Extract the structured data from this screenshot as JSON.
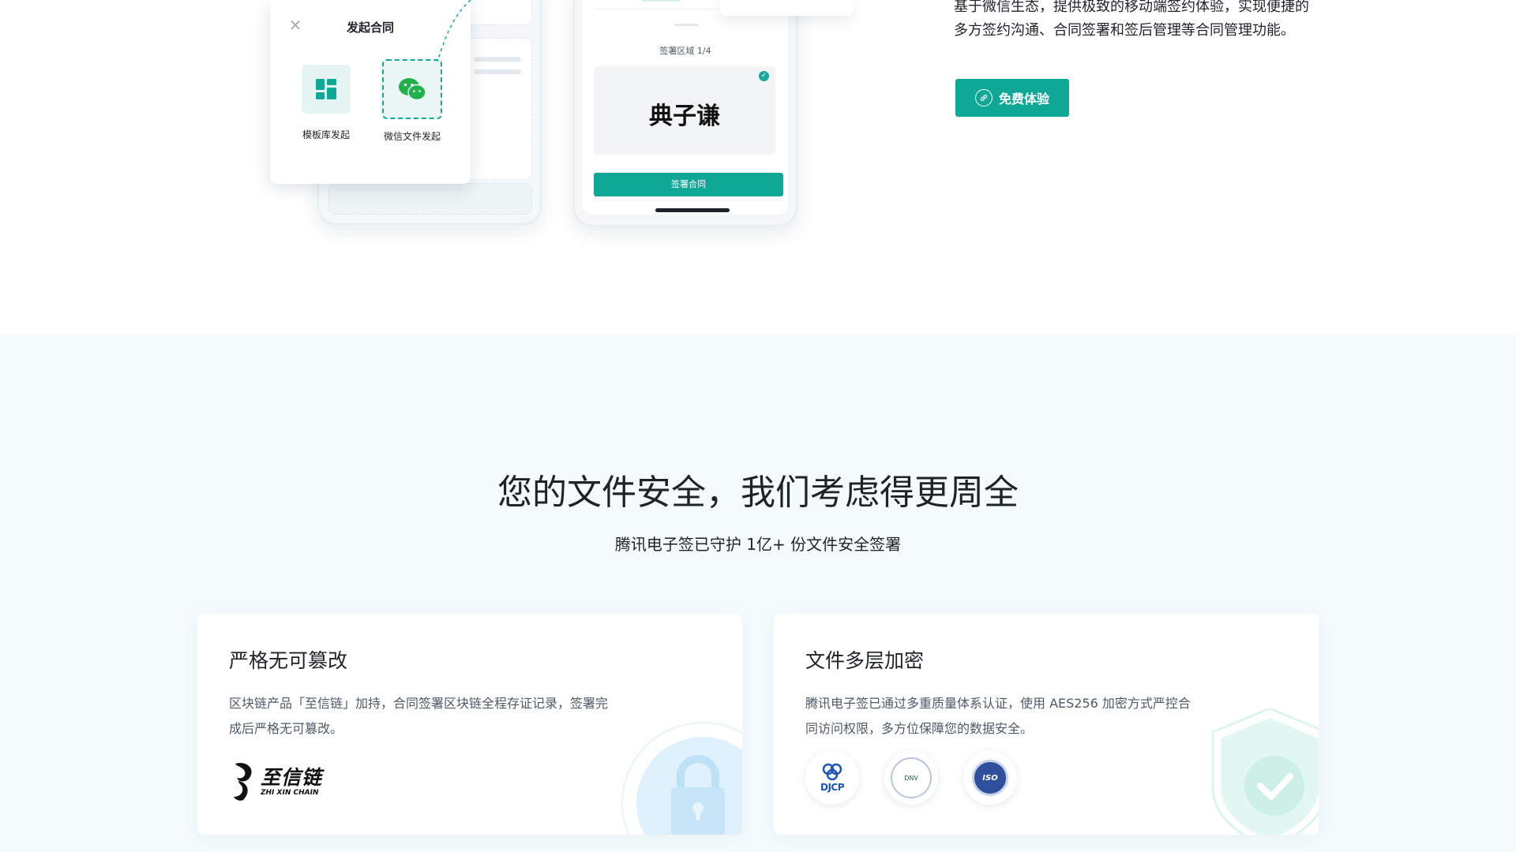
{
  "popup": {
    "title": "发起合同",
    "close_icon": "close-icon",
    "options": [
      {
        "label": "模板库发起",
        "icon": "template-grid-icon"
      },
      {
        "label": "微信文件发起",
        "icon": "wechat-icon"
      }
    ]
  },
  "phone": {
    "area_label": "签署区域 1/4",
    "signature": "典子谦",
    "sign_button": "签署合同"
  },
  "intro": {
    "line1": "基于微信生态，提供极致的移动端签约体验，实现便捷的",
    "line2": "多方签约沟通、合同签署和签后管理等合同管理功能。",
    "cta_label": "免费体验",
    "cta_icon": "link-icon"
  },
  "security": {
    "title": "您的文件安全，我们考虑得更周全",
    "subtitle": "腾讯电子签已守护 1亿+ 份文件安全签署",
    "cards": [
      {
        "title": "严格无可篡改",
        "desc": "区块链产品「至信链」加持，合同签署区块链全程存证记录，签署完成后严格无可篡改。",
        "logo_cn": "至信链",
        "logo_en": "ZHI XIN CHAIN"
      },
      {
        "title": "文件多层加密",
        "desc": "腾讯电子签已通过多重质量体系认证，使用 AES256 加密方式严控合同访问权限，多方位保障您的数据安全。",
        "certs": [
          {
            "label": "DJCP",
            "icon": "djcp-badge-icon"
          },
          {
            "label": "DNV",
            "icon": "dnv-badge-icon"
          },
          {
            "label": "ISO",
            "icon": "iso-badge-icon"
          }
        ]
      }
    ]
  },
  "colors": {
    "accent": "#0fa897",
    "section_bg": "#f5fbfd",
    "text": "#1f2329",
    "muted": "#4e5969"
  }
}
